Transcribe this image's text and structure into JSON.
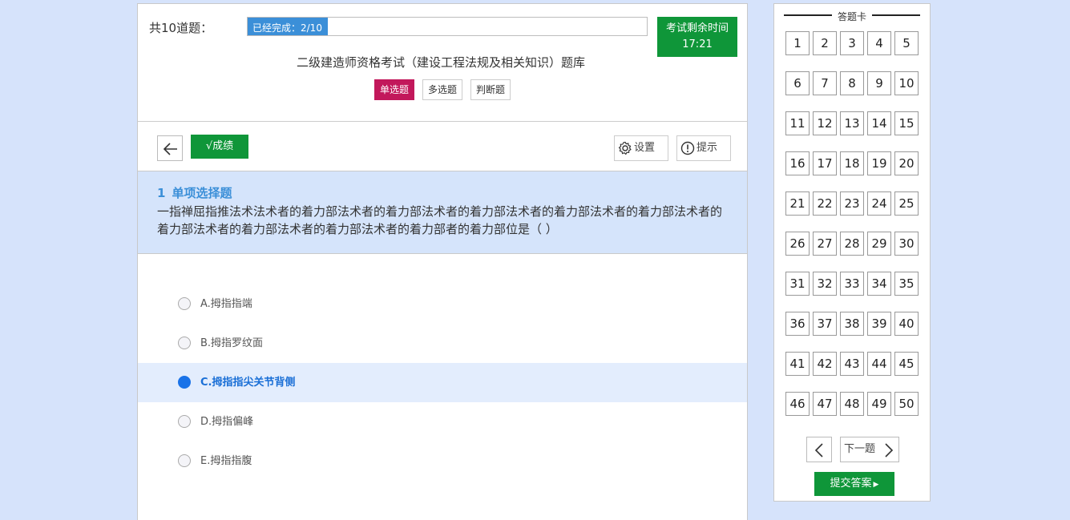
{
  "header": {
    "total_label": "共10道题：",
    "progress_label": "已经完成：2/10",
    "progress_fraction": 0.2,
    "timer_label": "考试剩余时间",
    "timer_value": "17:21",
    "exam_title": "二级建造师资格考试（建设工程法规及相关知识）题库",
    "types": [
      {
        "label": "单选题",
        "active": true
      },
      {
        "label": "多选题",
        "active": false
      },
      {
        "label": "判断题",
        "active": false
      }
    ]
  },
  "toolbar": {
    "score_label": "√成绩",
    "settings_label": "设置",
    "hint_label": "提示"
  },
  "question": {
    "number": "1",
    "type": "单项选择题",
    "text": "一指禅屈指推法术法术者的着力部法术者的着力部法术者的着力部法术者的着力部法术者的着力部法术者的着力部法术者的着力部法术者的着力部法术者的着力部者的着力部位是（ ）"
  },
  "options": [
    {
      "label": "A.拇指指端",
      "selected": false
    },
    {
      "label": "B.拇指罗纹面",
      "selected": false
    },
    {
      "label": "C.拇指指尖关节背侧",
      "selected": true
    },
    {
      "label": "D.拇指偏峰",
      "selected": false
    },
    {
      "label": "E.拇指指腹",
      "selected": false
    }
  ],
  "answer_card": {
    "title": "答题卡",
    "numbers": [
      "1",
      "2",
      "3",
      "4",
      "5",
      "6",
      "7",
      "8",
      "9",
      "10",
      "11",
      "12",
      "13",
      "14",
      "15",
      "16",
      "17",
      "18",
      "19",
      "20",
      "21",
      "22",
      "23",
      "24",
      "25",
      "26",
      "27",
      "28",
      "29",
      "30",
      "31",
      "32",
      "33",
      "34",
      "35",
      "36",
      "37",
      "38",
      "39",
      "40",
      "41",
      "42",
      "43",
      "44",
      "45",
      "46",
      "47",
      "48",
      "49",
      "50"
    ],
    "next_label": "下一题",
    "submit_label": "提交答案"
  },
  "colors": {
    "page_bg": "#d6e3fb",
    "green": "#0f9639",
    "progress_blue": "#3b8fd8",
    "active_tab": "#c2185b",
    "selected_option": "#1a73e8"
  }
}
